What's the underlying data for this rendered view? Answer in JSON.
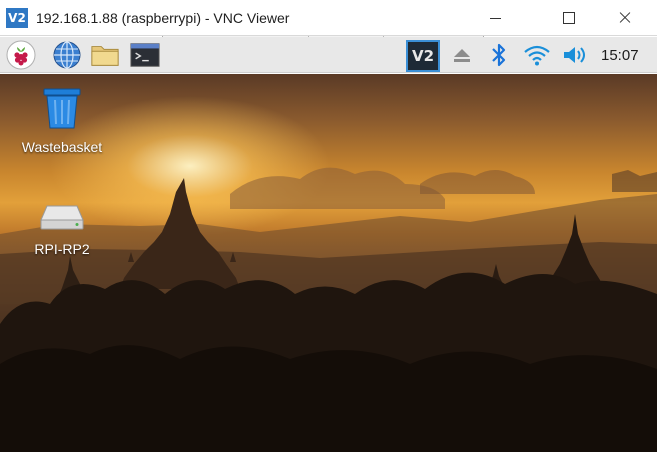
{
  "window": {
    "app_icon_text": "V2",
    "title": "192.168.1.88 (raspberrypi) - VNC Viewer"
  },
  "panel": {
    "launchers": [
      "raspberry-menu-icon",
      "web-browser-icon",
      "file-manager-icon",
      "terminal-icon"
    ],
    "tray": {
      "vnc_label": "V2",
      "icons": [
        "vnc-server-icon",
        "eject-icon",
        "bluetooth-icon",
        "wifi-icon",
        "volume-icon"
      ]
    },
    "clock": "15:07"
  },
  "desktop": {
    "icons": [
      {
        "label": "Wastebasket",
        "icon": "wastebasket-icon"
      },
      {
        "label": "RPI-RP2",
        "icon": "drive-icon"
      }
    ]
  },
  "colors": {
    "panel_bg": "#e8e8e8",
    "vnc_accent": "#3b8fd6",
    "bluetooth": "#1a73d9",
    "wifi": "#1a8fd9"
  }
}
